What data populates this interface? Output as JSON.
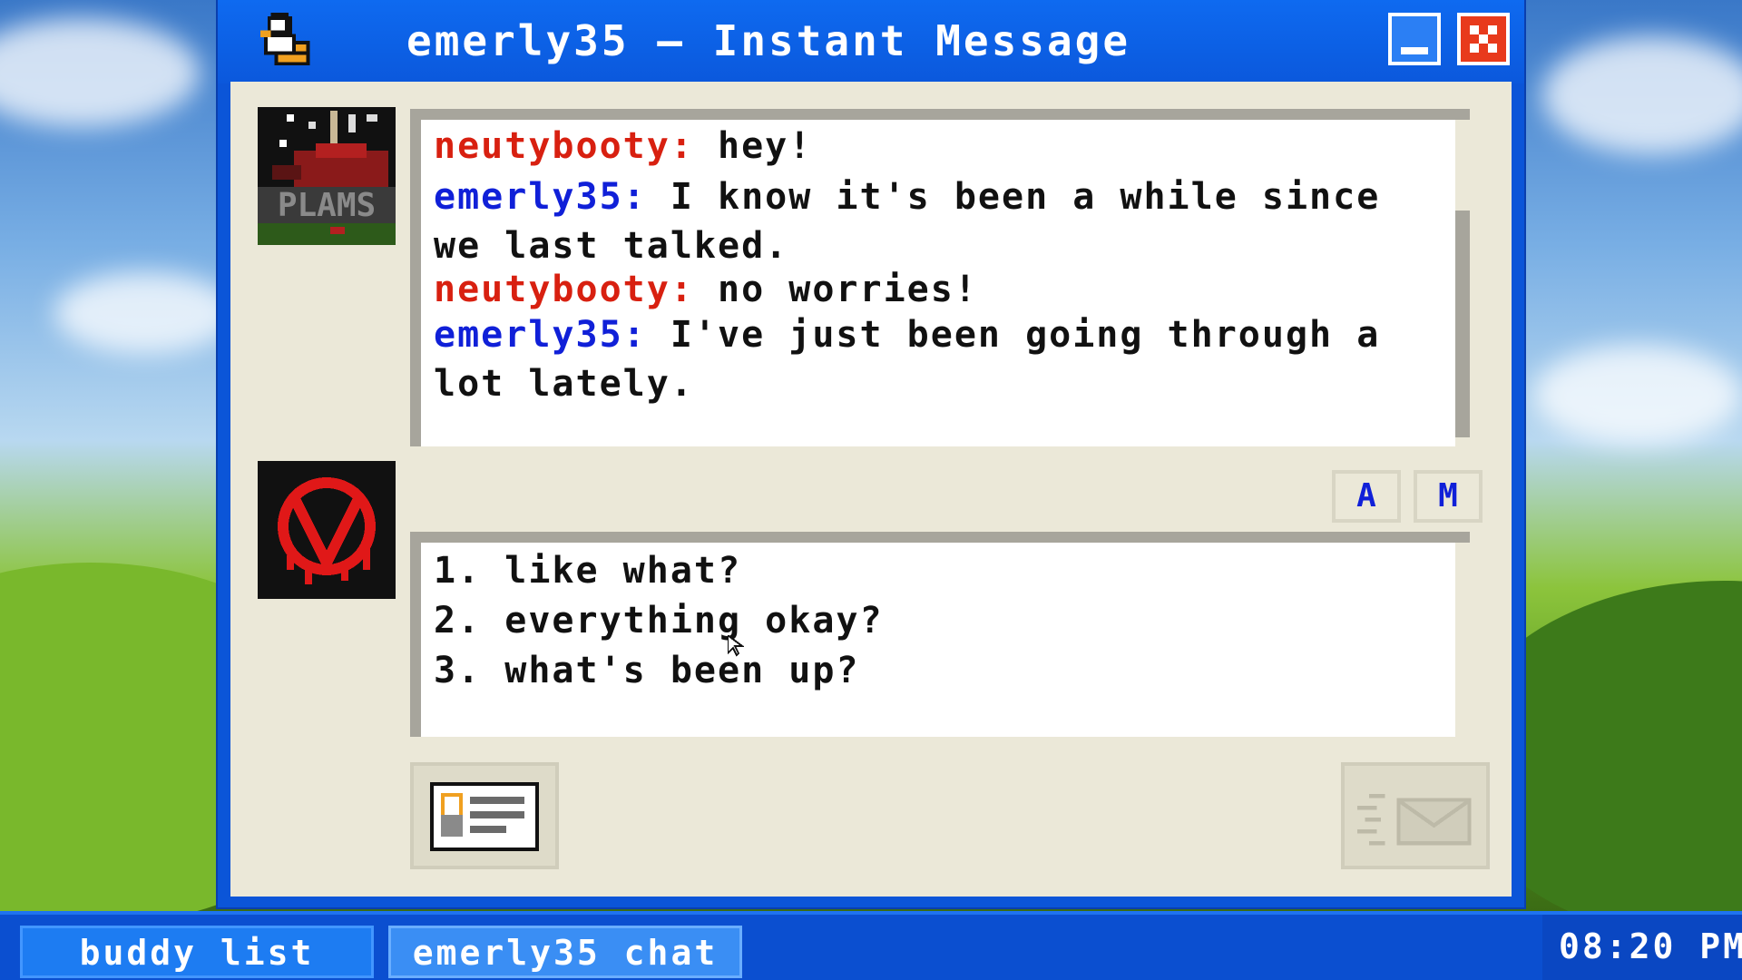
{
  "window": {
    "title": "emerly35 – Instant Message",
    "minimize_label": "minimize",
    "close_label": "close"
  },
  "conversation": [
    {
      "sender": "neutybooty:",
      "text": " hey!",
      "color": "#d82010"
    },
    {
      "sender": "emerly35:",
      "text": " I know it's been a while since we last talked.",
      "color": "#1020d8"
    },
    {
      "sender": "neutybooty:",
      "text": " no worries!",
      "color": "#d82010"
    },
    {
      "sender": "emerly35:",
      "text": " I've just been going through a lot lately.",
      "color": "#1020d8"
    }
  ],
  "avatars": {
    "buddy_icon_text": "PLAMS"
  },
  "format_buttons": {
    "font": "A",
    "emoticon": "M"
  },
  "reply_options": [
    "1. like what?",
    "2. everything okay?",
    "3. what's been up?"
  ],
  "taskbar": {
    "buddy_list": "buddy list",
    "chat_tab": "emerly35 chat",
    "clock": "08:20 PM"
  },
  "colors": {
    "window_blue": "#0b55d8",
    "client_bg": "#ebe8d8",
    "sender_red": "#d82010",
    "sender_blue": "#1020d8"
  },
  "icons": {
    "title": "duck-icon",
    "profile": "profile-card-icon",
    "send": "send-envelope-icon"
  }
}
